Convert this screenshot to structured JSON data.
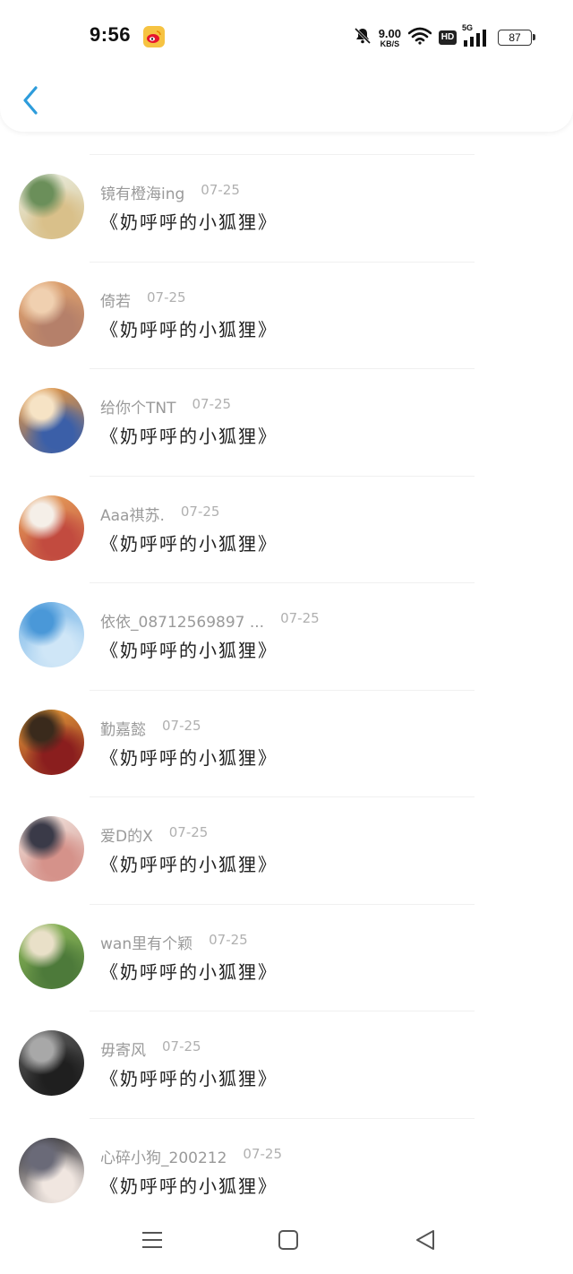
{
  "status_bar": {
    "time": "9:56",
    "net_speed_value": "9.00",
    "net_speed_unit": "KB/S",
    "hd_label": "HD",
    "network_type": "5G",
    "battery_level": "87"
  },
  "comments": [
    {
      "username": "镜有橙海ing",
      "date": "07-25",
      "content": "《奶呼呼的小狐狸》",
      "avatar_colors": [
        "#e9efe3",
        "#d9c08a",
        "#6b8f5a"
      ]
    },
    {
      "username": "倚若",
      "date": "07-25",
      "content": "《奶呼呼的小狐狸》",
      "avatar_colors": [
        "#e2a36c",
        "#b5806a",
        "#f0d0b0"
      ]
    },
    {
      "username": "给你个TNT",
      "date": "07-25",
      "content": "《奶呼呼的小狐狸》",
      "avatar_colors": [
        "#f29a3a",
        "#3b5fa8",
        "#f6e3c5"
      ]
    },
    {
      "username": "Aaa祺苏.",
      "date": "07-25",
      "content": "《奶呼呼的小狐狸》",
      "avatar_colors": [
        "#e8a35a",
        "#c24b3f",
        "#f5efe8"
      ]
    },
    {
      "username": "依依_08712569897 ...",
      "date": "07-25",
      "content": "《奶呼呼的小狐狸》",
      "avatar_colors": [
        "#7cb8e8",
        "#cfe6f7",
        "#4a98d8"
      ]
    },
    {
      "username": "勤嘉懿",
      "date": "07-25",
      "content": "《奶呼呼的小狐狸》",
      "avatar_colors": [
        "#e6a13a",
        "#8a1e1e",
        "#3a2a1c"
      ]
    },
    {
      "username": "爱D的X",
      "date": "07-25",
      "content": "《奶呼呼的小狐狸》",
      "avatar_colors": [
        "#f1e6e0",
        "#d5928a",
        "#3a3a48"
      ]
    },
    {
      "username": "wan里有个颖",
      "date": "07-25",
      "content": "《奶呼呼的小狐狸》",
      "avatar_colors": [
        "#8fba5a",
        "#4d7a3a",
        "#e9e0c8"
      ]
    },
    {
      "username": "毋寄风",
      "date": "07-25",
      "content": "《奶呼呼的小狐狸》",
      "avatar_colors": [
        "#5a5a5a",
        "#1f1f1f",
        "#a8a8a8"
      ]
    },
    {
      "username": "心碎小狗_200212",
      "date": "07-25",
      "content": "《奶呼呼的小狐狸》",
      "avatar_colors": [
        "#2a2a30",
        "#f0e6e0",
        "#6a6a78"
      ]
    }
  ],
  "colors": {
    "accent": "#2d9cdb",
    "username": "#9a9a9a",
    "date": "#b0b0b0",
    "content": "#222222"
  }
}
